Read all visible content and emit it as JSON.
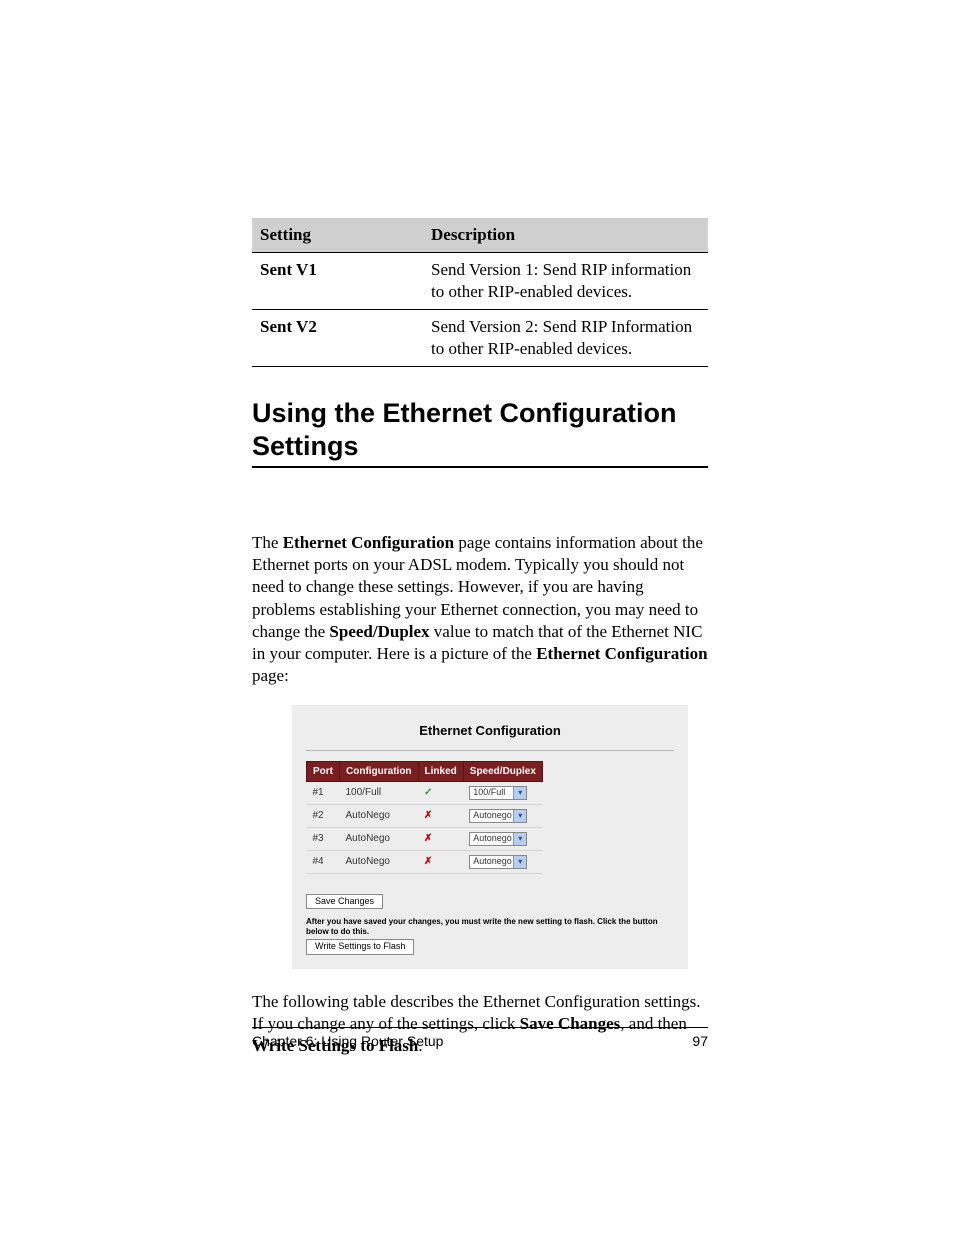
{
  "ref_table": {
    "headers": {
      "setting": "Setting",
      "description": "Description"
    },
    "rows": [
      {
        "setting": "Sent V1",
        "description": "Send Version 1: Send RIP information to other RIP-enabled devices."
      },
      {
        "setting": "Sent V2",
        "description": "Send Version 2: Send RIP Information to other RIP-enabled devices."
      }
    ]
  },
  "section_heading": "Using the Ethernet Configuration Settings",
  "intro": {
    "pre1": "The ",
    "bold1": "Ethernet Configuration",
    "mid1": " page contains information about the Ethernet ports on your ADSL modem. Typically you should not need to change these settings. However, if you are having problems establishing your Ethernet connection, you may need to change the ",
    "bold2": "Speed/Duplex",
    "mid2": " value to match that of the Ethernet NIC in your computer. Here is a picture of the ",
    "bold3": "Ethernet Configuration",
    "post": " page:"
  },
  "screenshot": {
    "title": "Ethernet Configuration",
    "headers": {
      "port": "Port",
      "config": "Configuration",
      "linked": "Linked",
      "speed": "Speed/Duplex"
    },
    "rows": [
      {
        "port": "#1",
        "config": "100/Full",
        "linked": "check",
        "speed": "100/Full"
      },
      {
        "port": "#2",
        "config": "AutoNego",
        "linked": "cross",
        "speed": "Autonego"
      },
      {
        "port": "#3",
        "config": "AutoNego",
        "linked": "cross",
        "speed": "Autonego"
      },
      {
        "port": "#4",
        "config": "AutoNego",
        "linked": "cross",
        "speed": "Autonego"
      }
    ],
    "save_btn": "Save Changes",
    "note": "After you have saved your changes, you must write the new setting to flash. Click the button below to do this.",
    "write_btn": "Write Settings to Flash"
  },
  "outro": {
    "pre": "The following table describes the Ethernet Configuration settings. If you change any of the settings, click ",
    "bold1": "Save Changes",
    "mid": ", and then ",
    "bold2": "Write Settings to Flash",
    "post": "."
  },
  "footer": {
    "chapter": "Chapter 6: Using Router Setup",
    "page": "97"
  }
}
